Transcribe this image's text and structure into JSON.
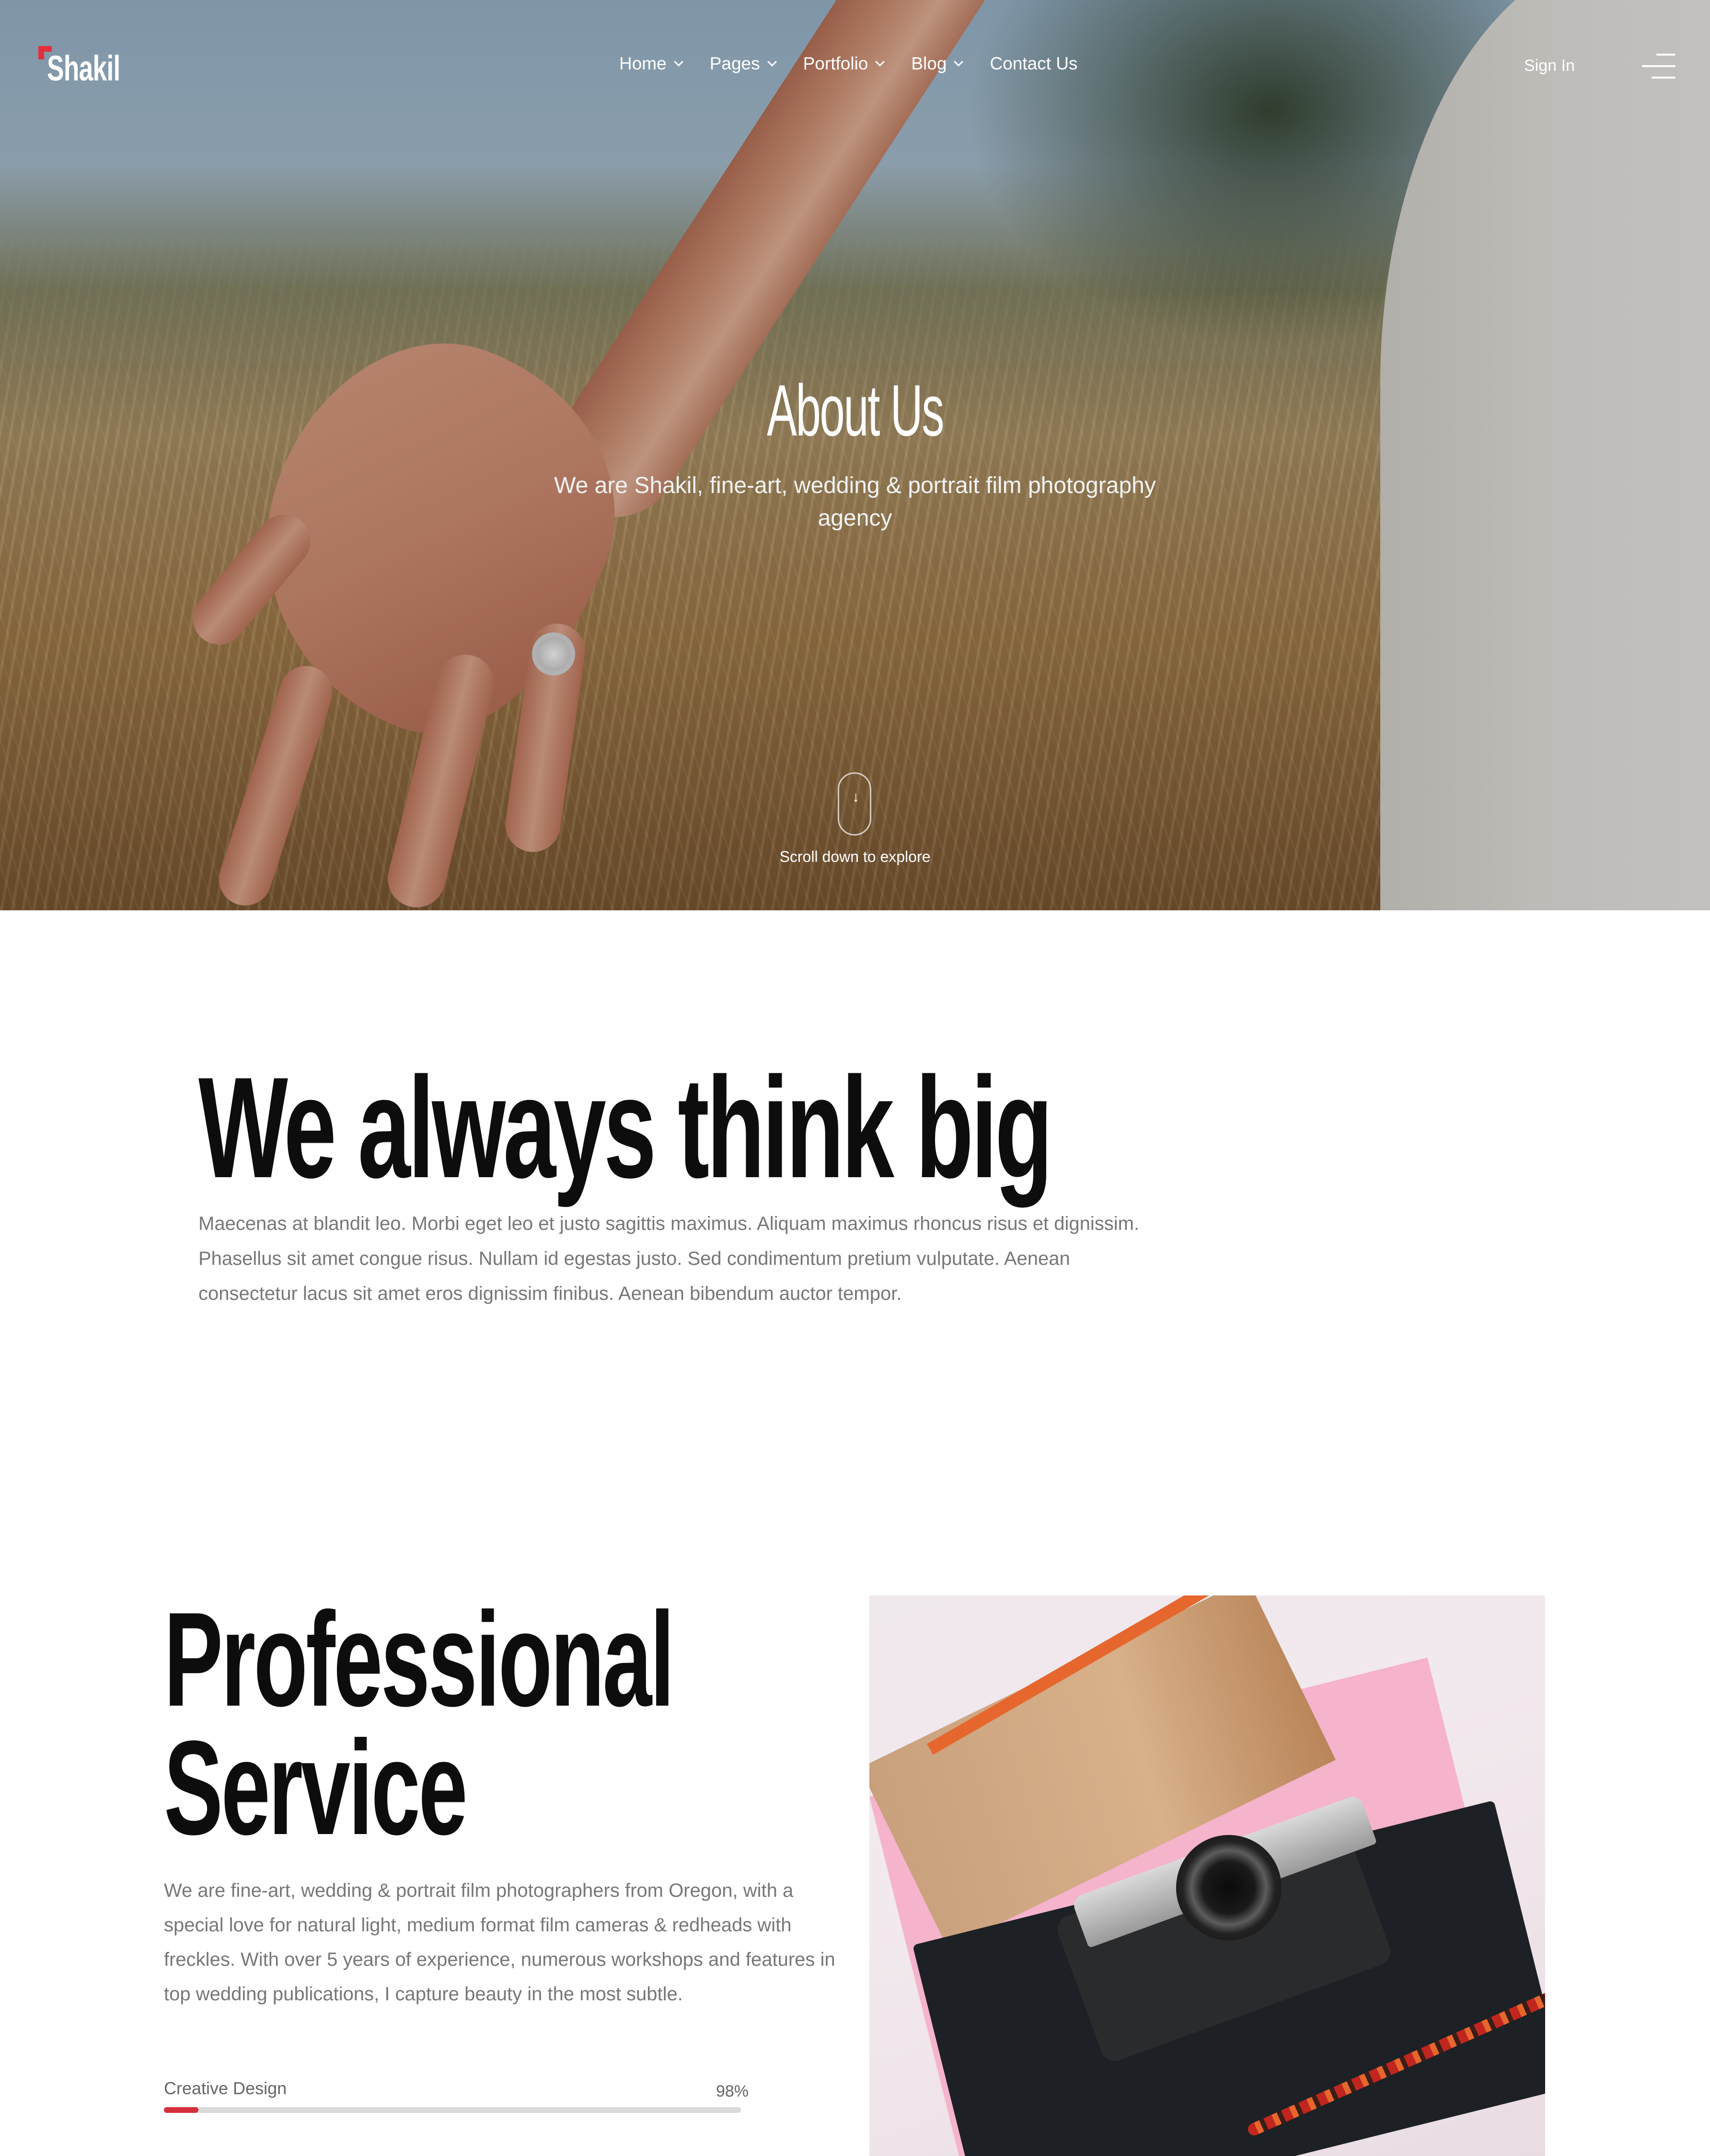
{
  "brand": {
    "name": "Shakil",
    "accent_color": "#e52e3b"
  },
  "nav": {
    "items": [
      {
        "label": "Home",
        "has_dropdown": true
      },
      {
        "label": "Pages",
        "has_dropdown": true
      },
      {
        "label": "Portfolio",
        "has_dropdown": true
      },
      {
        "label": "Blog",
        "has_dropdown": true
      },
      {
        "label": "Contact Us",
        "has_dropdown": false
      }
    ],
    "sign_in": "Sign In",
    "menu_icon": "hamburger-menu-icon"
  },
  "hero": {
    "title": "About Us",
    "subtitle": "We are Shakil, fine-art, wedding & portrait film photography agency",
    "scroll_icon": "mouse-scroll-icon",
    "scroll_text": "Scroll down to explore"
  },
  "think_big": {
    "title": "We always think big",
    "description": "Maecenas at blandit leo. Morbi eget leo et justo sagittis maximus. Aliquam maximus rhoncus risus et dignissim. Phasellus sit amet congue risus. Nullam id egestas justo. Sed condimentum pretium vulputate. Aenean consectetur lacus sit amet eros dignissim finibus. Aenean bibendum auctor tempor."
  },
  "professional": {
    "title_line1": "Professional",
    "title_line2": "Service",
    "description": "We are fine-art, wedding & portrait film photographers from Oregon, with a special love for natural light, medium format film cameras & redheads with freckles. With over 5 years of experience, numerous workshops and features in top wedding publications, I capture beauty in the most subtle.",
    "skills": [
      {
        "label": "Creative Design",
        "percent_text": "98%",
        "fill_fraction": 0.06
      }
    ],
    "skill_bar_color": "#d3313c"
  }
}
